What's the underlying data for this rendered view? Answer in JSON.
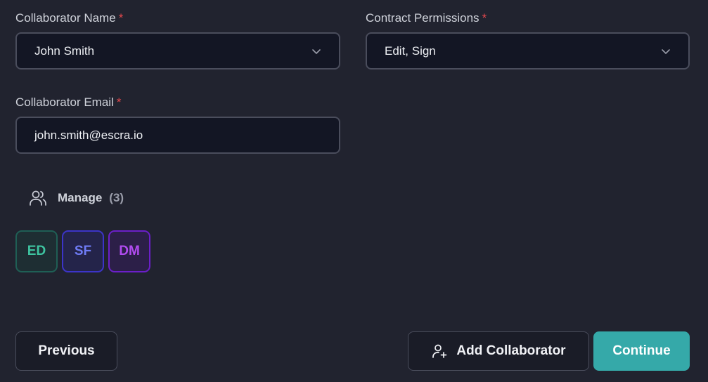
{
  "form": {
    "name_label": "Collaborator Name",
    "name_value": "John Smith",
    "permissions_label": "Contract Permissions",
    "permissions_value": "Edit, Sign",
    "email_label": "Collaborator Email",
    "email_value": "john.smith@escra.io",
    "required_mark": "*"
  },
  "manage": {
    "title": "Manage",
    "count": "(3)",
    "icon": "users-icon"
  },
  "collaborators": [
    {
      "initials": "ED",
      "color": "#3ec4a0",
      "border": "#1f5f55",
      "bg": "#1e2e33"
    },
    {
      "initials": "SF",
      "color": "#6f7cf6",
      "border": "#3c34c8",
      "bg": "#24244a"
    },
    {
      "initials": "DM",
      "color": "#b14cf0",
      "border": "#6b1fc9",
      "bg": "#2c1f48"
    }
  ],
  "actions": {
    "previous": "Previous",
    "add_collaborator": "Add Collaborator",
    "continue": "Continue"
  },
  "colors": {
    "background": "#21232f",
    "field_bg": "#131624",
    "accent": "#35a9a9",
    "required": "#e5484d"
  }
}
